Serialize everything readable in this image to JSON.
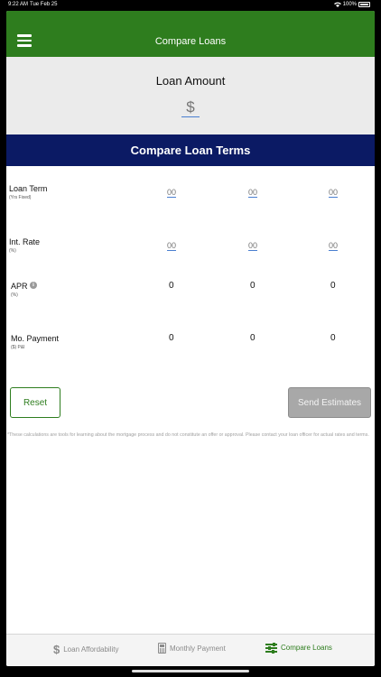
{
  "status_bar": {
    "time": "9:22 AM",
    "date": "Tue Feb 25",
    "battery": "100%"
  },
  "header": {
    "title": "Compare Loans"
  },
  "loan_amount": {
    "label": "Loan Amount",
    "placeholder": "$",
    "value": ""
  },
  "banner": {
    "title": "Compare Loan Terms"
  },
  "rows": {
    "loan_term": {
      "label": "Loan Term",
      "sub": "(Yrs Fixed)",
      "placeholders": [
        "00",
        "00",
        "00"
      ]
    },
    "int_rate": {
      "label": "Int. Rate",
      "sub": "(%)",
      "placeholders": [
        "00",
        "00",
        "00"
      ]
    },
    "apr": {
      "label": "APR",
      "sub": "(%)",
      "values": [
        "0",
        "0",
        "0"
      ]
    },
    "mo_payment": {
      "label": "Mo. Payment",
      "sub": "($) P&I",
      "values": [
        "0",
        "0",
        "0"
      ]
    }
  },
  "buttons": {
    "reset": "Reset",
    "send": "Send Estimates"
  },
  "disclaimer": "*These calculations are tools for learning about the mortgage process and do not constitute an offer or approval.  Please contact your loan officer for actual rates and terms.",
  "tabs": [
    {
      "label": "Loan Affordability",
      "icon": "dollar-icon"
    },
    {
      "label": "Monthly Payment",
      "icon": "calculator-icon"
    },
    {
      "label": "Compare Loans",
      "icon": "sliders-icon",
      "active": true
    }
  ],
  "colors": {
    "header": "#2e7d1e",
    "banner": "#0b1a64",
    "accent": "#2e7d1e",
    "input_underline": "#4a7fd0"
  }
}
